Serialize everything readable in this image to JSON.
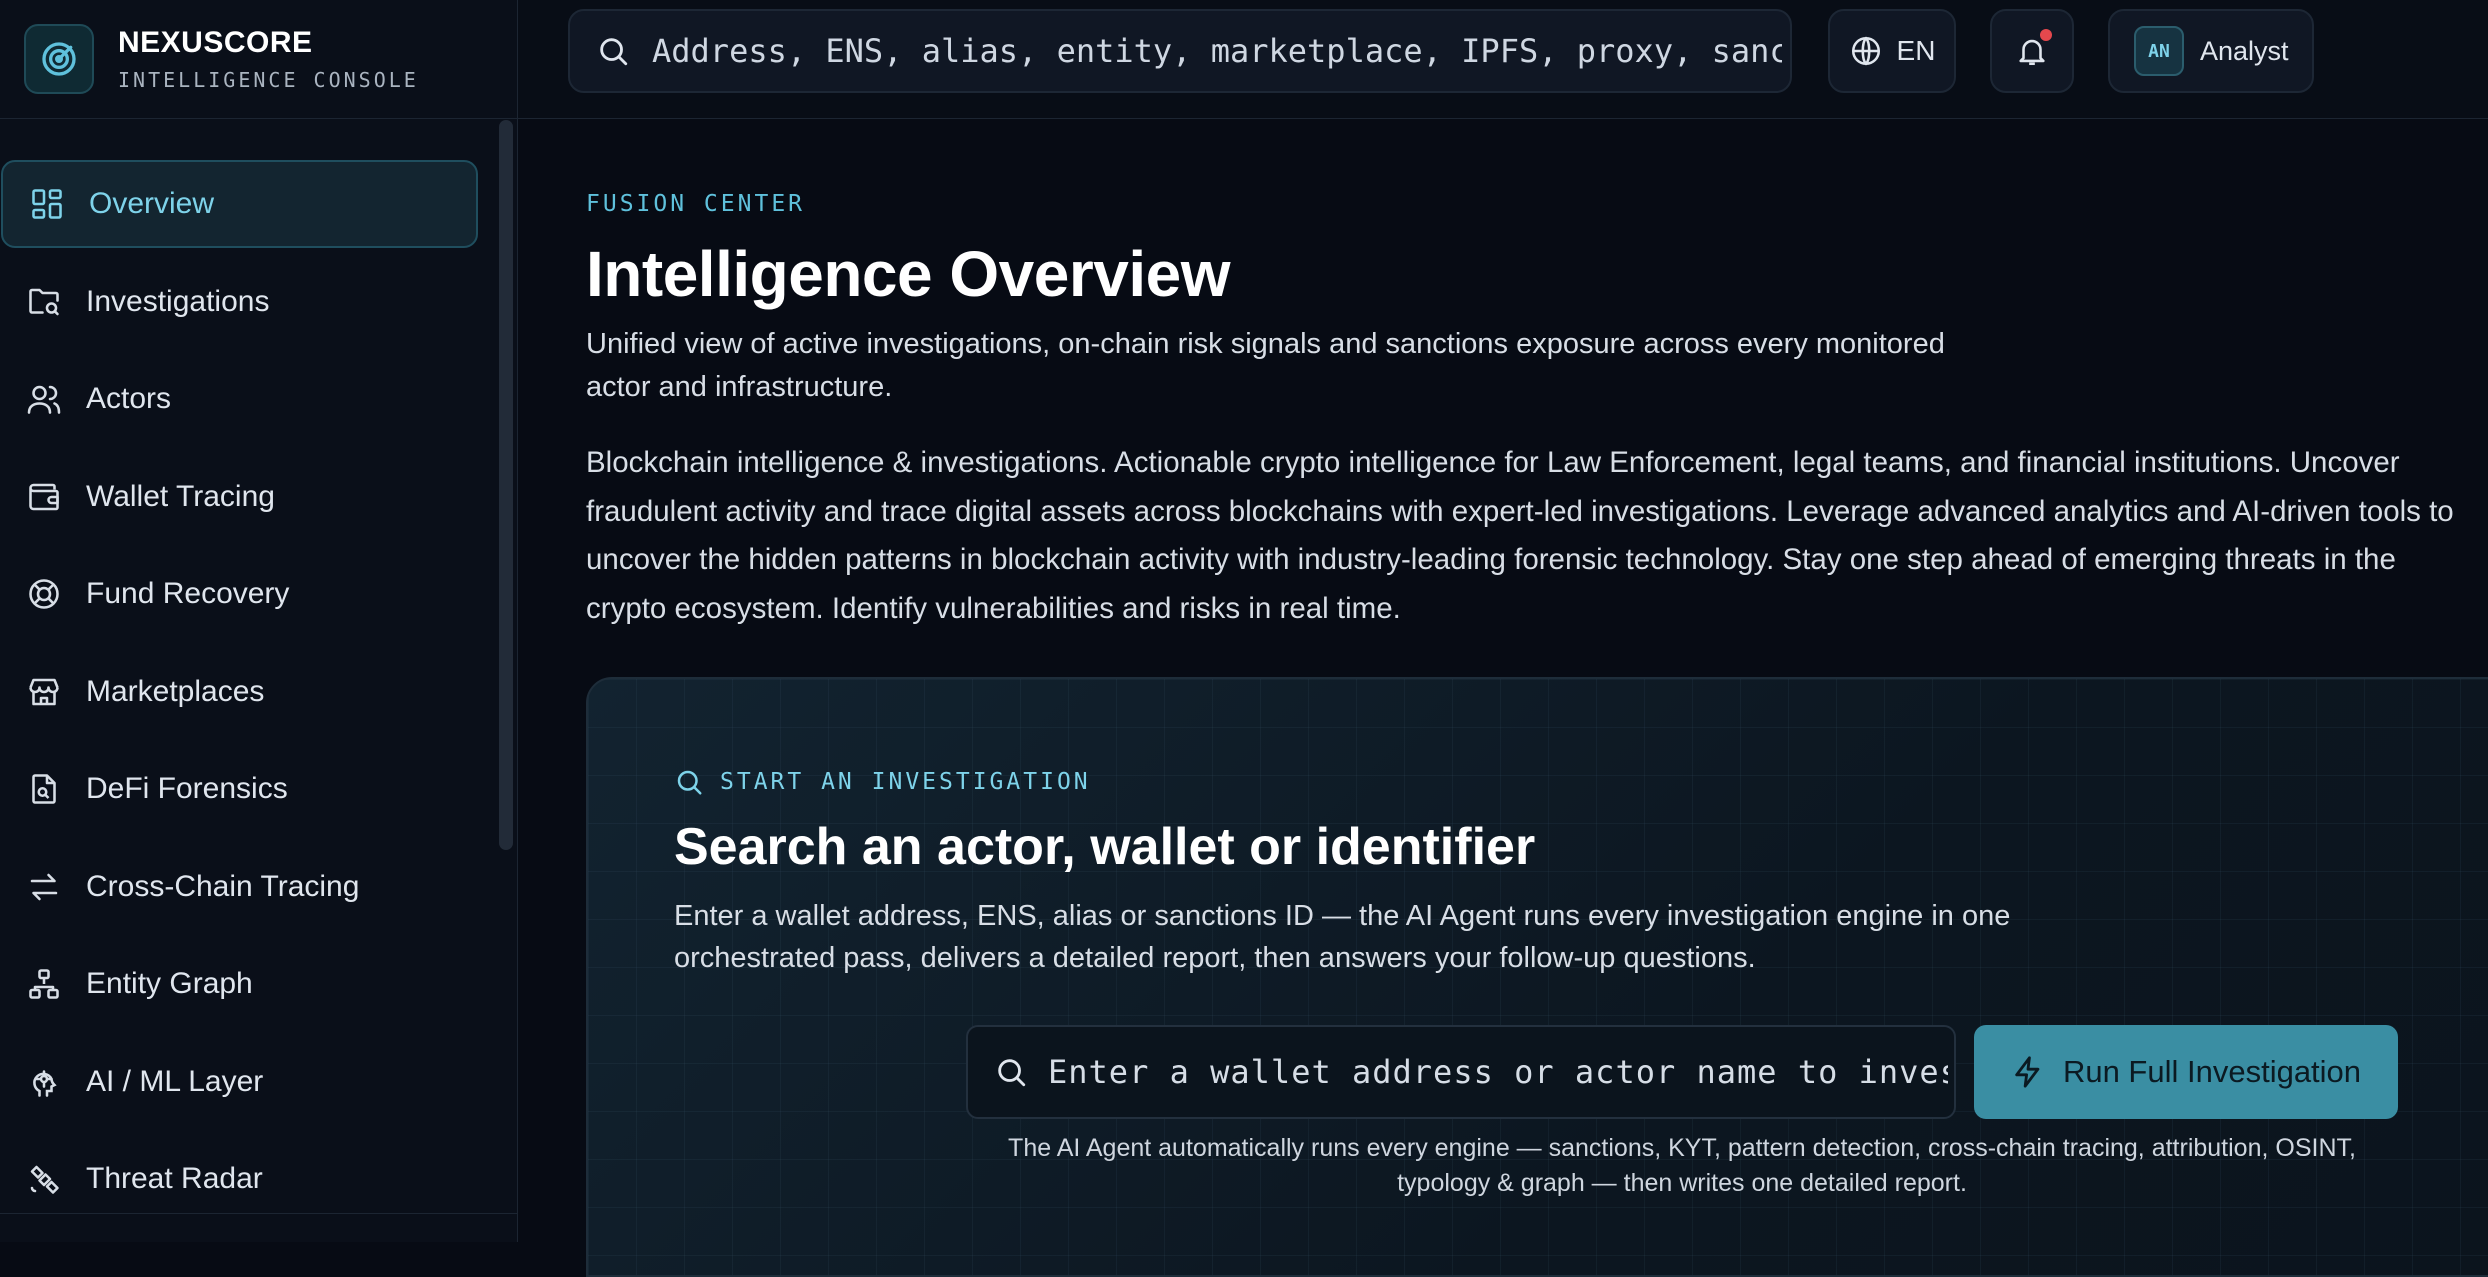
{
  "brand": {
    "name": "NEXUSCORE",
    "subtitle": "INTELLIGENCE CONSOLE",
    "logo_icon": "radar-icon"
  },
  "sidebar": {
    "items": [
      {
        "label": "Overview",
        "icon": "dashboard-icon",
        "active": true
      },
      {
        "label": "Investigations",
        "icon": "folder-search-icon"
      },
      {
        "label": "Actors",
        "icon": "users-icon"
      },
      {
        "label": "Wallet Tracing",
        "icon": "wallet-icon"
      },
      {
        "label": "Fund Recovery",
        "icon": "lifebuoy-icon"
      },
      {
        "label": "Marketplaces",
        "icon": "store-icon"
      },
      {
        "label": "DeFi Forensics",
        "icon": "file-search-icon"
      },
      {
        "label": "Cross-Chain Tracing",
        "icon": "arrows-exchange-icon"
      },
      {
        "label": "Entity Graph",
        "icon": "network-icon"
      },
      {
        "label": "AI / ML Layer",
        "icon": "brain-icon"
      },
      {
        "label": "Threat Radar",
        "icon": "satellite-icon"
      }
    ]
  },
  "topbar": {
    "search_placeholder": "Address, ENS, alias, entity, marketplace, IPFS, proxy, sanctio",
    "language": "EN",
    "notification_badge_color": "#e5484d",
    "user": {
      "initials": "AN",
      "name": "Analyst"
    }
  },
  "main": {
    "eyebrow": "FUSION CENTER",
    "title": "Intelligence Overview",
    "subtitle": "Unified view of active investigations, on-chain risk signals and sanctions exposure across every monitored actor and infrastructure.",
    "description": "Blockchain intelligence & investigations. Actionable crypto intelligence for Law Enforcement, legal teams, and financial institutions. Uncover fraudulent activity and trace digital assets across blockchains with expert-led investigations. Leverage advanced analytics and AI-driven tools to uncover the hidden patterns in blockchain activity with industry-leading forensic technology. Stay one step ahead of emerging threats in the crypto ecosystem. Identify vulnerabilities and risks in real time."
  },
  "investigation": {
    "eyebrow": "START AN INVESTIGATION",
    "title": "Search an actor, wallet or identifier",
    "text": "Enter a wallet address, ENS, alias or sanctions ID — the AI Agent runs every investigation engine in one orchestrated pass, delivers a detailed report, then answers your follow-up questions.",
    "input_placeholder": "Enter a wallet address or actor name to investigate",
    "run_button": "Run Full Investigation",
    "note": "The AI Agent automatically runs every engine — sanctions, KYT, pattern detection, cross-chain tracing, attribution, OSINT, typology & graph — then writes one detailed report."
  },
  "colors": {
    "accent": "#7ed3ea",
    "button": "#3a8ea3",
    "background": "#070b14"
  }
}
